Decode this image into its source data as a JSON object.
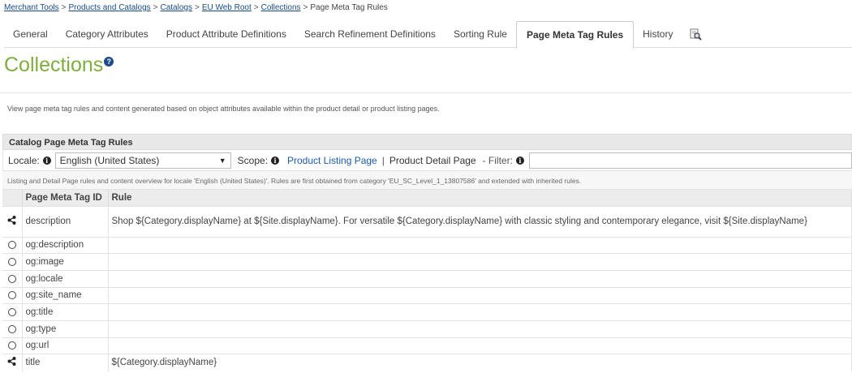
{
  "breadcrumb": {
    "items": [
      "Merchant Tools",
      "Products and Catalogs",
      "Catalogs",
      "EU Web Root",
      "Collections"
    ],
    "current": "Page Meta Tag Rules",
    "separator": ">"
  },
  "tabs": [
    {
      "label": "General"
    },
    {
      "label": "Category Attributes"
    },
    {
      "label": "Product Attribute Definitions"
    },
    {
      "label": "Search Refinement Definitions"
    },
    {
      "label": "Sorting Rule"
    },
    {
      "label": "Page Meta Tag Rules",
      "active": true
    },
    {
      "label": "History"
    }
  ],
  "tab_icon": "search-preview-icon",
  "page": {
    "title": "Collections",
    "help_icon": "?",
    "description": "View page meta tag rules and content generated based on object attributes available within the product detail or product listing pages."
  },
  "section": {
    "title": "Catalog Page Meta Tag Rules",
    "locale_label": "Locale:",
    "locale_value": "English (United States)",
    "scope_label": "Scope:",
    "scope_link": "Product Listing Page",
    "scope_sep": "|",
    "scope_plain": "Product Detail Page",
    "filter_label": "- Filter:",
    "filter_value": "",
    "info_glyph": "i",
    "overview": "Listing and Detail Page rules and content overview for locale 'English (United States)'. Rules are first obtained from category 'EU_SC_Level_1_13807586' and extended with inherited rules."
  },
  "table": {
    "headers": [
      "",
      "Page Meta Tag ID",
      "Rule"
    ],
    "rows": [
      {
        "icon": "share",
        "id": "description",
        "rule": "Shop ${Category.displayName} at ${Site.displayName}. For versatile ${Category.displayName} with classic styling and contemporary elegance, visit ${Site.displayName}"
      },
      {
        "icon": "radio",
        "id": "og:description",
        "rule": ""
      },
      {
        "icon": "radio",
        "id": "og:image",
        "rule": ""
      },
      {
        "icon": "radio",
        "id": "og:locale",
        "rule": ""
      },
      {
        "icon": "radio",
        "id": "og:site_name",
        "rule": ""
      },
      {
        "icon": "radio",
        "id": "og:title",
        "rule": ""
      },
      {
        "icon": "radio",
        "id": "og:type",
        "rule": ""
      },
      {
        "icon": "radio",
        "id": "og:url",
        "rule": ""
      },
      {
        "icon": "share",
        "id": "title",
        "rule": "${Category.displayName}"
      }
    ]
  },
  "colors": {
    "title_green": "#7fae3e",
    "link_blue": "#1a5aa8",
    "help_blue": "#1e4b8a"
  }
}
